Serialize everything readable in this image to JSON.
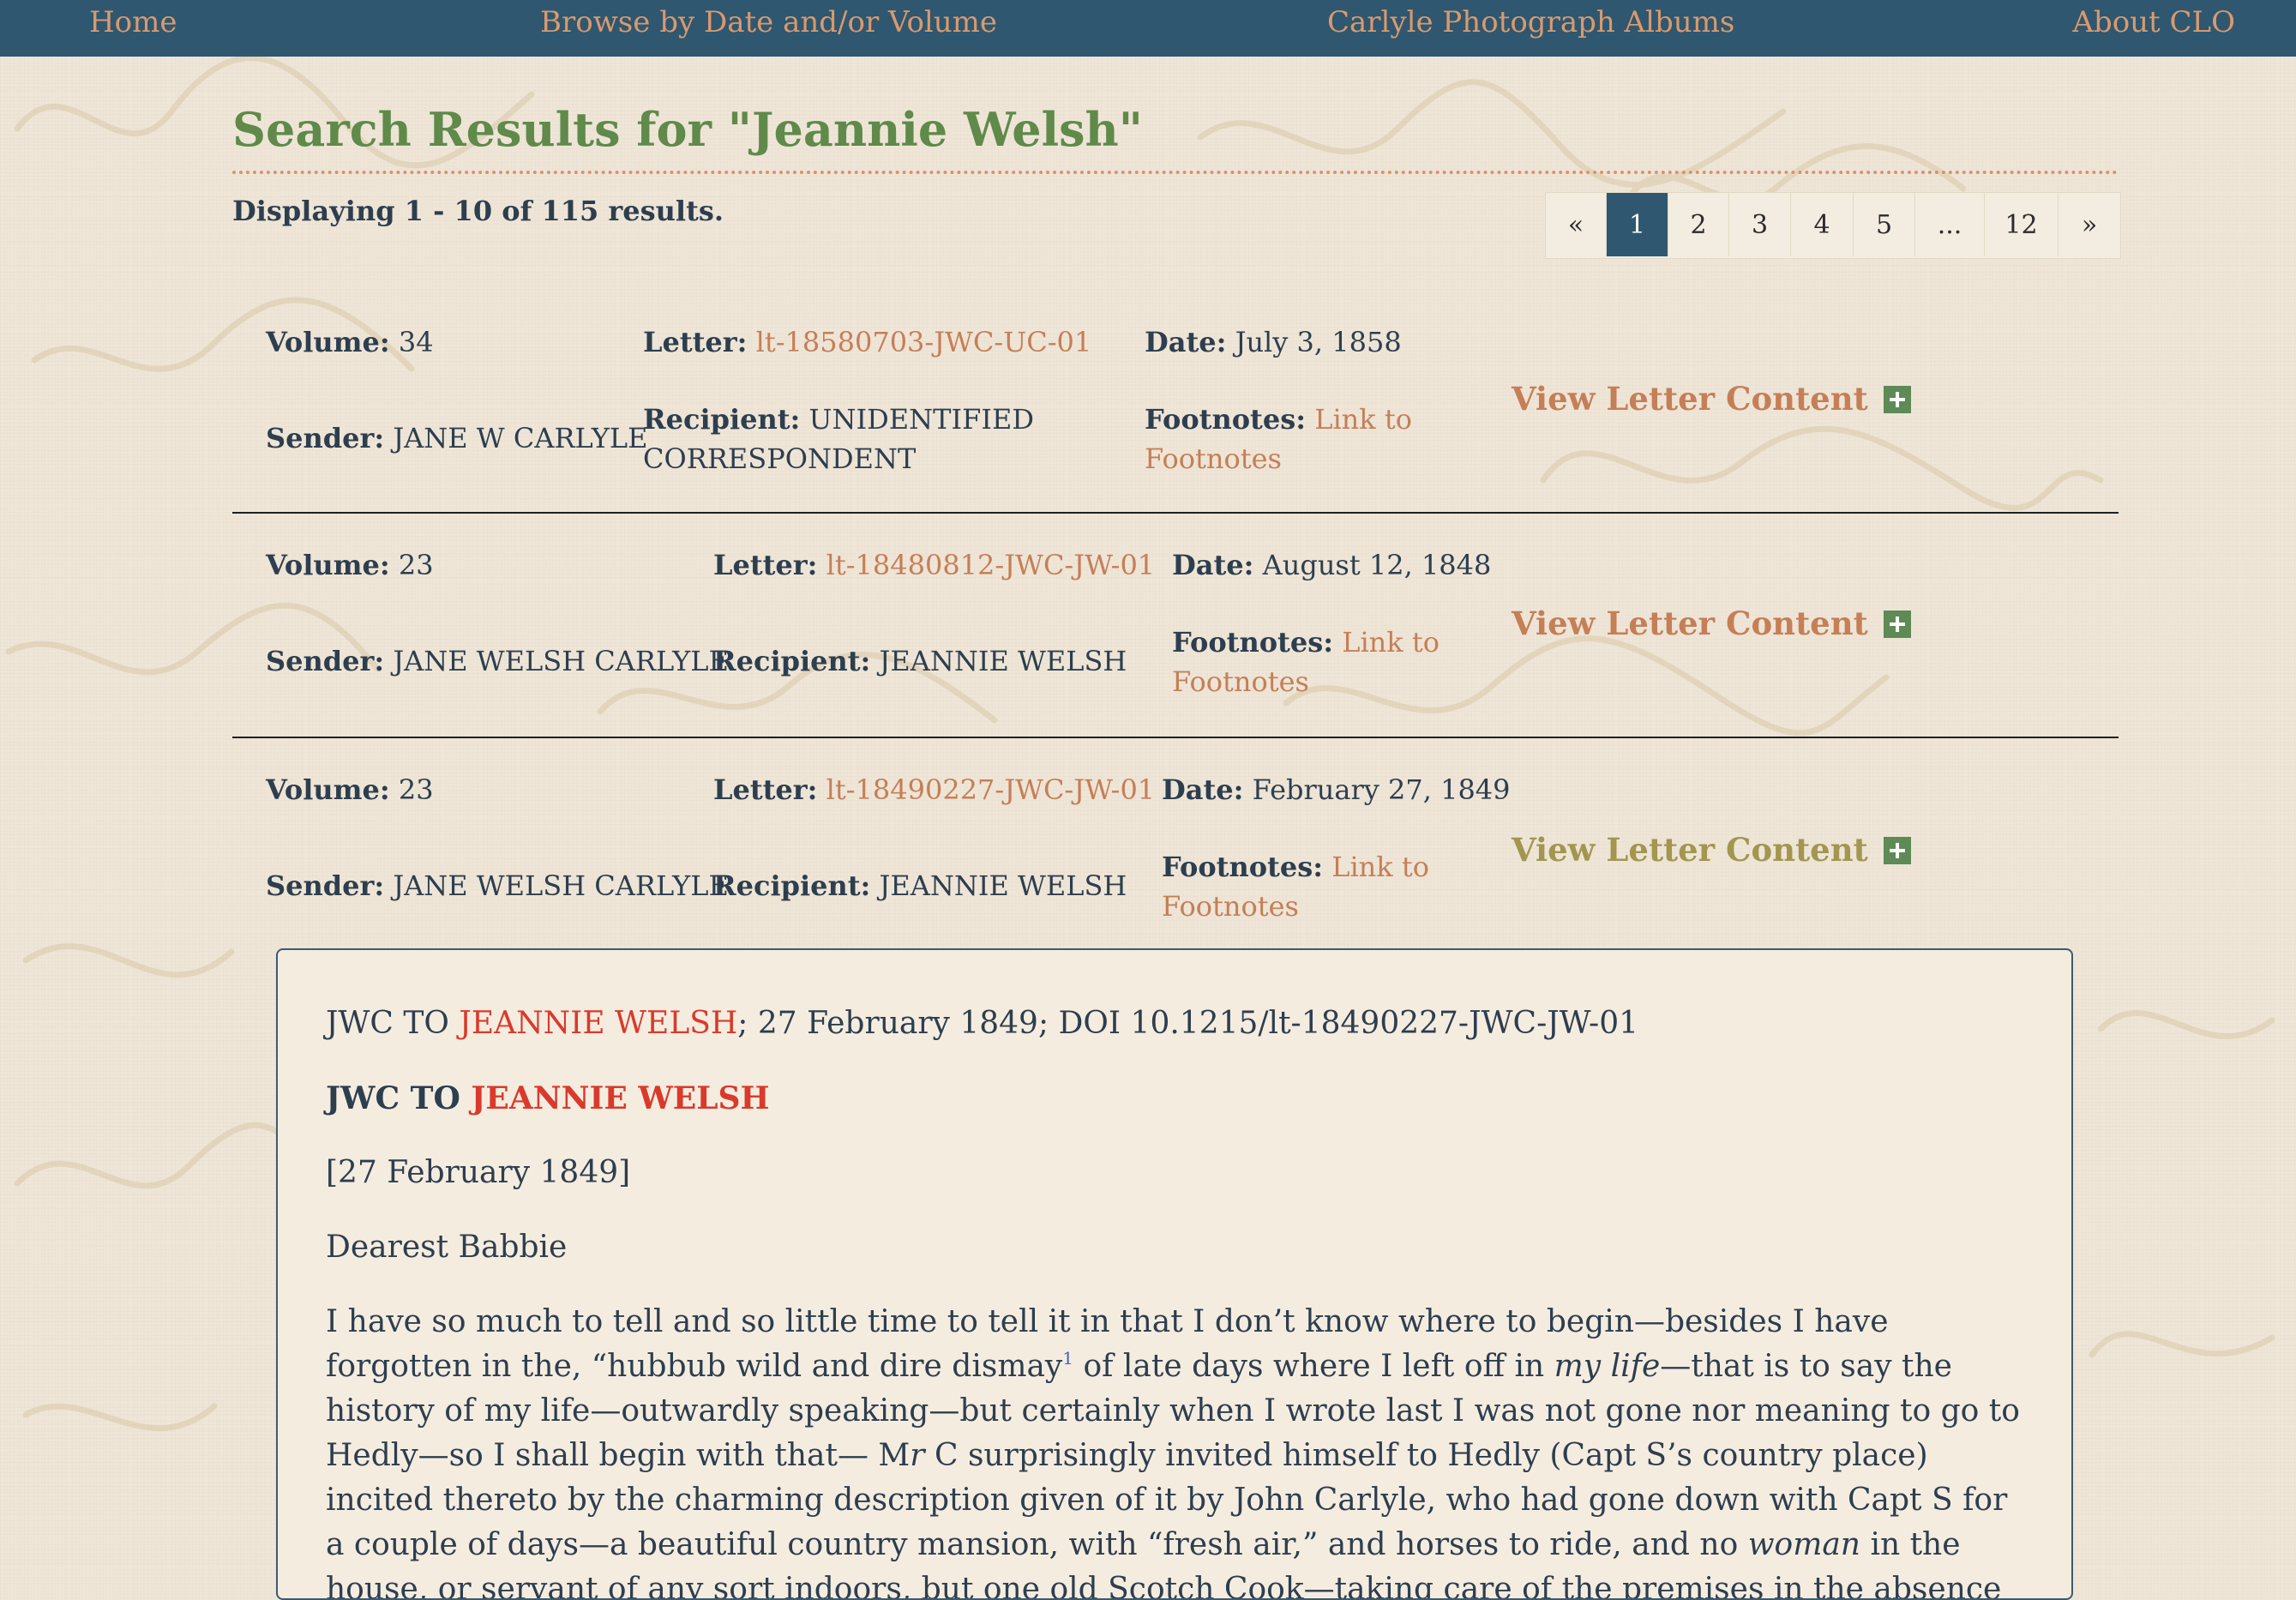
{
  "nav": {
    "home": "Home",
    "browse": "Browse by Date and/or Volume",
    "albums": "Carlyle Photograph Albums",
    "about": "About CLO"
  },
  "search": {
    "title": "Search Results for \"Jeannie Welsh\"",
    "count": "Displaying 1 - 10 of 115 results."
  },
  "pagination": [
    "«",
    "1",
    "2",
    "3",
    "4",
    "5",
    "...",
    "12",
    "»"
  ],
  "pagination_active": "1",
  "labels": {
    "volume": "Volume:",
    "letter": "Letter:",
    "date": "Date:",
    "sender": "Sender:",
    "recipient": "Recipient:",
    "footnotes": "Footnotes:",
    "footnotes_link": "Link to Footnotes",
    "view": "View Letter Content"
  },
  "results": [
    {
      "volume": "34",
      "letter": "lt-18580703-JWC-UC-01",
      "date": "July 3, 1858",
      "sender": "JANE W CARLYLE",
      "recipient": "UNIDENTIFIED CORRESPONDENT"
    },
    {
      "volume": "23",
      "letter": "lt-18480812-JWC-JW-01",
      "date": "August 12, 1848",
      "sender": "JANE WELSH CARLYLE",
      "recipient": "JEANNIE WELSH"
    },
    {
      "volume": "23",
      "letter": "lt-18490227-JWC-JW-01",
      "date": "February 27, 1849",
      "sender": "JANE WELSH CARLYLE",
      "recipient": "JEANNIE WELSH"
    }
  ],
  "letter_content": {
    "citation_prefix": "JWC TO ",
    "citation_name": "JEANNIE WELSH",
    "citation_suffix": "; 27 February 1849; DOI 10.1215/lt-18490227-JWC-JW-01",
    "heading_prefix": "JWC TO ",
    "heading_name": "JEANNIE WELSH",
    "date": "[27 February 1849]",
    "salutation": "Dearest Babbie",
    "body_1": "I have so much to tell and so little time to tell it in that I don’t know where to begin—besides I have forgotten in the, “hubbub wild and dire dismay",
    "footnote": "1",
    "body_2": " of late days where I left off in ",
    "body_italic_1": "my life",
    "body_3": "—that is to say the history of my life—outwardly speaking—but certainly when I wrote last I was not gone nor meaning to go to Hedly—so I shall begin with that— M",
    "body_italic_2": "r",
    "body_4": " C surprisingly invited himself to Hedly (Capt S’s country place) incited thereto by the charming description given of it by John Carlyle, who had gone down with Capt S for a couple of days—a beautiful country mansion, with “fresh air,” and horses to ride, and no ",
    "body_italic_3": "woman",
    "body_5": " in the house, or servant of any sort indoors, but one old Scotch Cook—taking care of the premises in the absence of Mrs Sterling and"
  },
  "colors": {
    "nav_bg": "#2f5770",
    "nav_link": "#d89a6e",
    "title_green": "#5f8a4a",
    "link_orange": "#c57f57",
    "highlight_red": "#d93a2b",
    "plus_green": "#5d8a55",
    "active_page": "#2f5770"
  }
}
